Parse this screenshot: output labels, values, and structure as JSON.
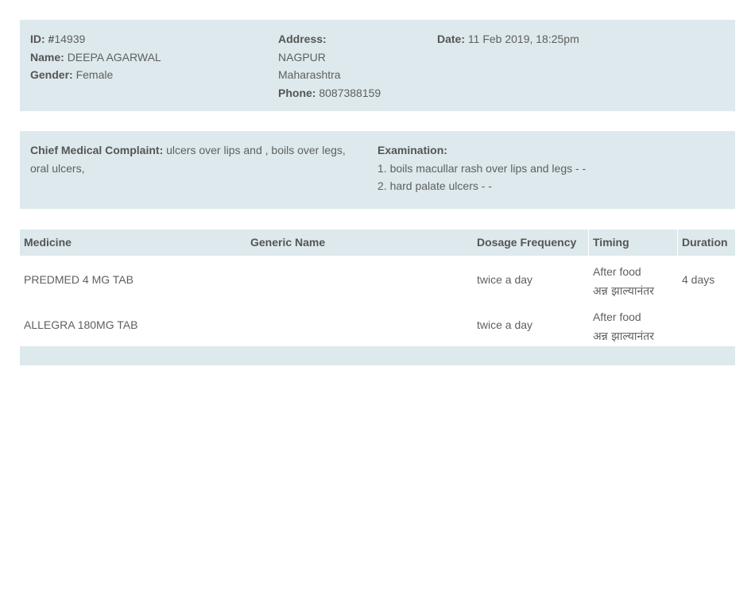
{
  "patient": {
    "id_label": "ID: #",
    "id_value": "14939",
    "name_label": "Name:",
    "name_value": "DEEPA AGARWAL",
    "gender_label": "Gender:",
    "gender_value": "Female"
  },
  "address": {
    "label": "Address:",
    "city": "NAGPUR",
    "state": "Maharashtra",
    "phone_label": "Phone:",
    "phone_value": "8087388159"
  },
  "visit": {
    "date_label": "Date:",
    "date_value": "11 Feb 2019, 18:25pm"
  },
  "complaint": {
    "label": "Chief Medical Complaint:",
    "text": "ulcers over lips and , boils over legs, oral ulcers,"
  },
  "examination": {
    "label": "Examination:",
    "items": [
      "1. boils macullar rash over lips and legs - -",
      "2. hard palate ulcers - -"
    ]
  },
  "table": {
    "headers": [
      "Medicine",
      "Generic Name",
      "Dosage Frequency",
      "Timing",
      "Duration"
    ],
    "rows": [
      {
        "medicine": "PREDMED 4 MG TAB",
        "generic": "",
        "dosage": "twice a day",
        "timing_en": "After food",
        "timing_hi": "अन्न झाल्यानंतर",
        "duration": "4 days"
      },
      {
        "medicine": "ALLEGRA 180MG TAB",
        "generic": "",
        "dosage": "twice a day",
        "timing_en": "After food",
        "timing_hi": "अन्न झाल्यानंतर",
        "duration": ""
      }
    ]
  }
}
